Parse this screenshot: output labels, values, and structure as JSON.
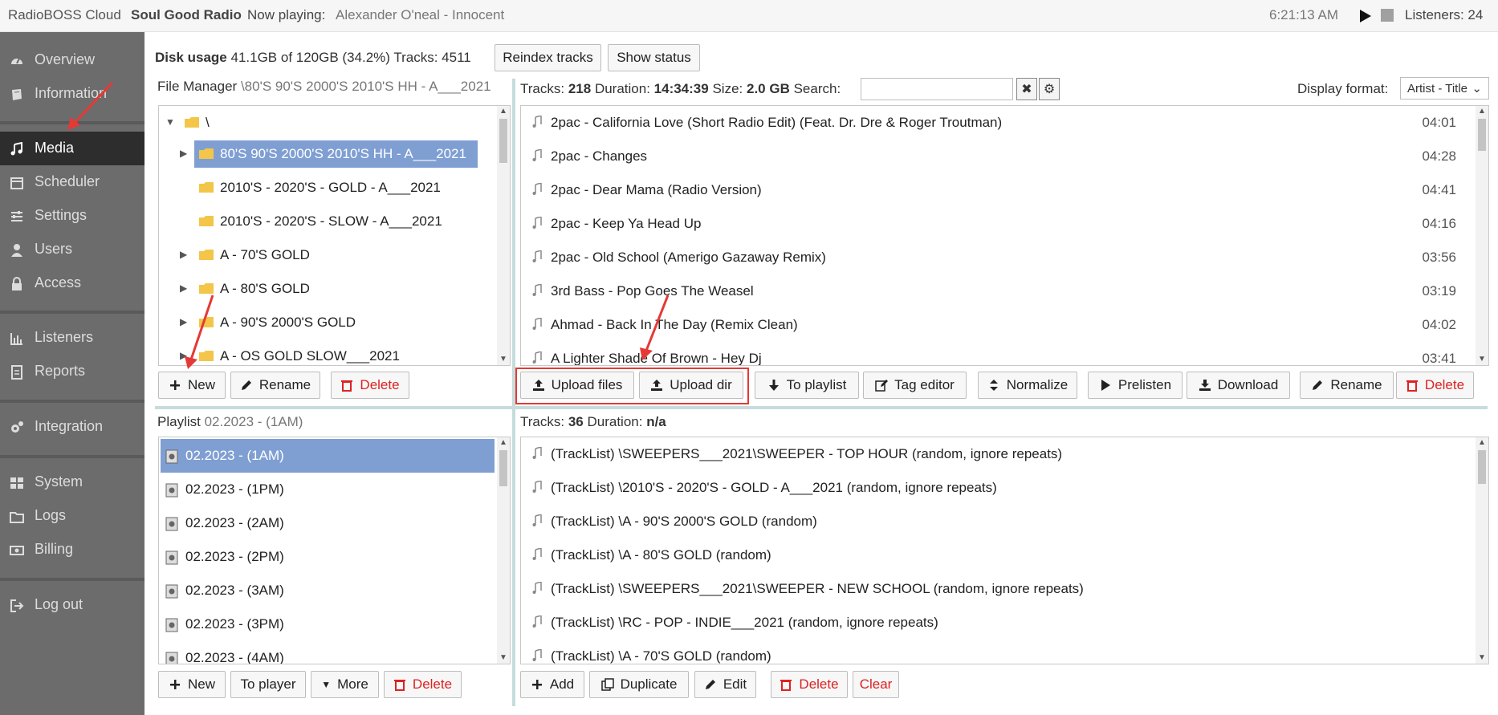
{
  "topbar": {
    "brand": "RadioBOSS Cloud",
    "station": "Soul Good Radio",
    "now_playing_label": "Now playing:",
    "now_playing": "Alexander O'neal - Innocent",
    "clock": "6:21:13 AM",
    "listeners": "Listeners: 24"
  },
  "sidebar": {
    "items": [
      {
        "label": "Overview",
        "icon": "dashboard-icon"
      },
      {
        "label": "Information",
        "icon": "book-icon"
      },
      {
        "label": "Media",
        "icon": "music-icon"
      },
      {
        "label": "Scheduler",
        "icon": "calendar-icon"
      },
      {
        "label": "Settings",
        "icon": "sliders-icon"
      },
      {
        "label": "Users",
        "icon": "user-icon"
      },
      {
        "label": "Access",
        "icon": "lock-icon"
      },
      {
        "label": "Listeners",
        "icon": "bar-chart-icon"
      },
      {
        "label": "Reports",
        "icon": "report-icon"
      },
      {
        "label": "Integration",
        "icon": "cogs-icon"
      },
      {
        "label": "System",
        "icon": "grid-icon"
      },
      {
        "label": "Logs",
        "icon": "folder-icon"
      },
      {
        "label": "Billing",
        "icon": "money-icon"
      },
      {
        "label": "Log out",
        "icon": "logout-icon"
      }
    ],
    "active": "Media"
  },
  "disk": {
    "label": "Disk usage",
    "value": "41.1GB of 120GB (34.2%) Tracks: 4511",
    "reindex": "Reindex tracks",
    "status": "Show status"
  },
  "file_manager": {
    "title": "File Manager",
    "path": "\\80'S 90'S 2000'S 2010'S HH - A___2021",
    "root": "\\",
    "folders": [
      {
        "label": "80'S 90'S 2000'S 2010'S HH - A___2021",
        "caret": "▶",
        "selected": true
      },
      {
        "label": "2010'S - 2020'S - GOLD - A___2021",
        "caret": ""
      },
      {
        "label": "2010'S - 2020'S - SLOW - A___2021",
        "caret": ""
      },
      {
        "label": "A - 70'S GOLD",
        "caret": "▶"
      },
      {
        "label": "A - 80'S GOLD",
        "caret": "▶"
      },
      {
        "label": "A - 90'S 2000'S GOLD",
        "caret": "▶"
      },
      {
        "label": "A - OS GOLD SLOW___2021",
        "caret": "▶"
      }
    ],
    "buttons": {
      "new": "New",
      "rename": "Rename",
      "delete": "Delete"
    }
  },
  "tracks": {
    "tracks_label": "Tracks:",
    "tracks_count": "218",
    "duration_label": "Duration:",
    "duration": "14:34:39",
    "size_label": "Size:",
    "size": "2.0 GB",
    "search_label": "Search:",
    "display_format_label": "Display format:",
    "display_format": "Artist - Title",
    "items": [
      {
        "title": "2pac - California Love (Short Radio Edit) (Feat. Dr. Dre & Roger Troutman)",
        "duration": "04:01"
      },
      {
        "title": "2pac - Changes",
        "duration": "04:28"
      },
      {
        "title": "2pac - Dear Mama (Radio Version)",
        "duration": "04:41"
      },
      {
        "title": "2pac - Keep Ya Head Up",
        "duration": "04:16"
      },
      {
        "title": "2pac - Old School (Amerigo Gazaway Remix)",
        "duration": "03:56"
      },
      {
        "title": "3rd Bass - Pop Goes The Weasel",
        "duration": "03:19"
      },
      {
        "title": "Ahmad - Back In The Day (Remix Clean)",
        "duration": "04:02"
      },
      {
        "title": "A Lighter Shade Of Brown - Hey Dj",
        "duration": "03:41"
      }
    ],
    "buttons": {
      "upload_files": "Upload files",
      "upload_dir": "Upload dir",
      "to_playlist": "To playlist",
      "tag_editor": "Tag editor",
      "normalize": "Normalize",
      "prelisten": "Prelisten",
      "download": "Download",
      "rename": "Rename",
      "delete": "Delete"
    }
  },
  "playlist": {
    "title": "Playlist",
    "current": "02.2023 - (1AM)",
    "items": [
      {
        "label": "02.2023 - (1AM)",
        "selected": true
      },
      {
        "label": "02.2023 - (1PM)"
      },
      {
        "label": "02.2023 - (2AM)"
      },
      {
        "label": "02.2023 - (2PM)"
      },
      {
        "label": "02.2023 - (3AM)"
      },
      {
        "label": "02.2023 - (3PM)"
      },
      {
        "label": "02.2023 - (4AM)"
      }
    ],
    "buttons": {
      "new": "New",
      "to_player": "To player",
      "more": "More",
      "delete": "Delete"
    }
  },
  "playlist_tracks": {
    "tracks_label": "Tracks:",
    "tracks_count": "36",
    "duration_label": "Duration:",
    "duration": "n/a",
    "items": [
      "(TrackList) \\SWEEPERS___2021\\SWEEPER - TOP HOUR (random, ignore repeats)",
      "(TrackList) \\2010'S - 2020'S - GOLD - A___2021 (random, ignore repeats)",
      "(TrackList) \\A - 90'S 2000'S GOLD (random)",
      "(TrackList) \\A - 80'S GOLD (random)",
      "(TrackList) \\SWEEPERS___2021\\SWEEPER - NEW SCHOOL (random, ignore repeats)",
      "(TrackList) \\RC - POP - INDIE___2021 (random, ignore repeats)",
      "(TrackList) \\A - 70'S GOLD (random)"
    ],
    "buttons": {
      "add": "Add",
      "duplicate": "Duplicate",
      "edit": "Edit",
      "delete": "Delete",
      "clear": "Clear"
    }
  },
  "colors": {
    "sidebar_bg": "#6c6c6c",
    "sidebar_active": "#2d2d2d",
    "selection": "#7f9fd3",
    "danger": "#dd2222",
    "annotation": "#e53935",
    "divider": "#c7dcdc"
  }
}
